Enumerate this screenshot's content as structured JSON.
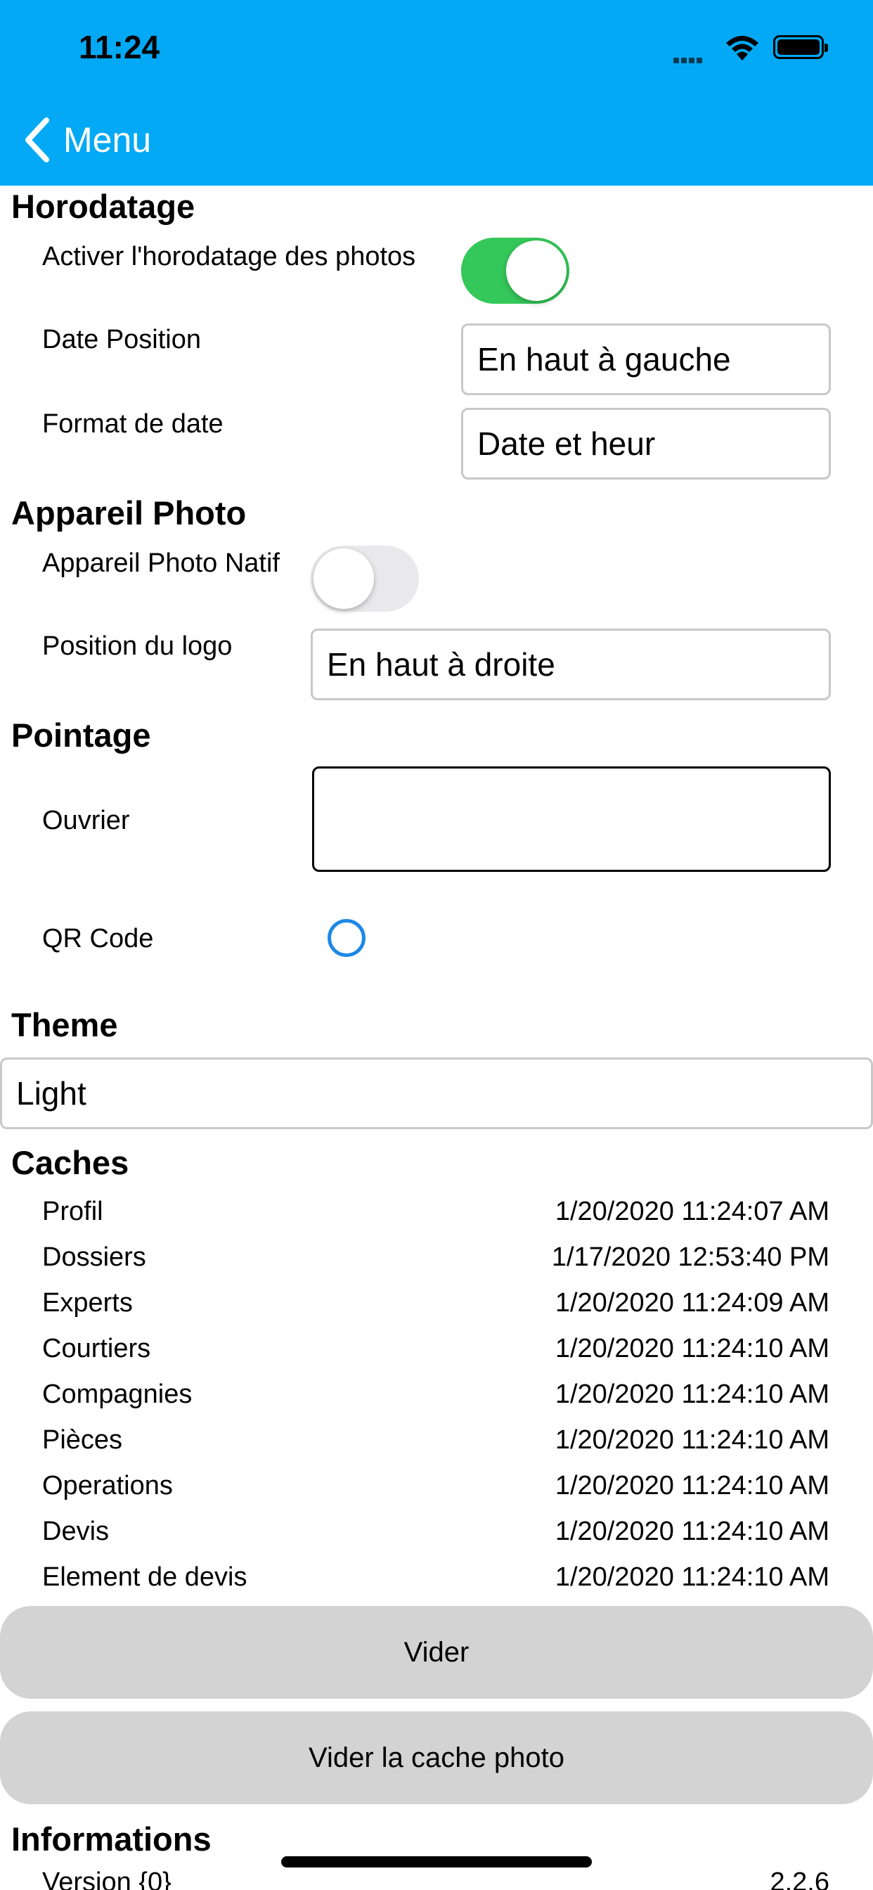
{
  "status_bar": {
    "time": "11:24"
  },
  "nav": {
    "back_label": "Menu"
  },
  "horodatage": {
    "title": "Horodatage",
    "activate_label": "Activer l'horodatage des photos",
    "activate_on": true,
    "date_position_label": "Date Position",
    "date_position_value": "En haut à gauche",
    "date_format_label": "Format de date",
    "date_format_value": "Date et heur"
  },
  "camera": {
    "title": "Appareil Photo",
    "native_label": "Appareil Photo Natif",
    "native_on": false,
    "logo_position_label": "Position du logo",
    "logo_position_value": "En haut à droite"
  },
  "pointage": {
    "title": "Pointage",
    "worker_label": "Ouvrier",
    "worker_value": "",
    "qr_label": "QR Code"
  },
  "theme": {
    "title": "Theme",
    "value": "Light"
  },
  "caches": {
    "title": "Caches",
    "items": [
      {
        "label": "Profil",
        "value": "1/20/2020 11:24:07 AM"
      },
      {
        "label": "Dossiers",
        "value": "1/17/2020 12:53:40 PM"
      },
      {
        "label": "Experts",
        "value": "1/20/2020 11:24:09 AM"
      },
      {
        "label": "Courtiers",
        "value": "1/20/2020 11:24:10 AM"
      },
      {
        "label": "Compagnies",
        "value": "1/20/2020 11:24:10 AM"
      },
      {
        "label": "Pièces",
        "value": "1/20/2020 11:24:10 AM"
      },
      {
        "label": "Operations",
        "value": "1/20/2020 11:24:10 AM"
      },
      {
        "label": "Devis",
        "value": "1/20/2020 11:24:10 AM"
      },
      {
        "label": "Element de devis",
        "value": "1/20/2020 11:24:10 AM"
      }
    ],
    "clear_button": "Vider",
    "clear_photo_button": "Vider la cache photo"
  },
  "informations": {
    "title": "Informations",
    "version_label": "Version {0}",
    "version_value": "2.2.6"
  },
  "colors": {
    "header": "#03A9F4",
    "toggle_on": "#34C759",
    "radio": "#1E88E5",
    "button_bg": "#D3D3D3"
  },
  "icons": {
    "back": "chevron-left-icon",
    "wifi": "wifi-icon",
    "battery": "battery-icon",
    "signal": "cellular-signal-icon"
  }
}
